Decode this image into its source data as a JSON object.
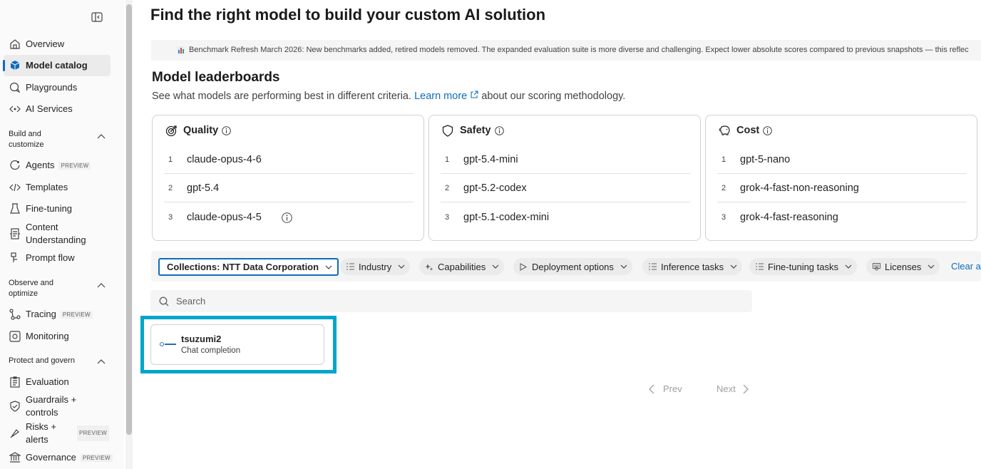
{
  "sidebar": {
    "items": [
      {
        "label": "Overview",
        "icon": "home-icon"
      },
      {
        "label": "Model catalog",
        "icon": "cube-icon",
        "active": true
      },
      {
        "label": "Playgrounds",
        "icon": "chat-icon"
      },
      {
        "label": "AI Services",
        "icon": "code-icon"
      }
    ],
    "build_section": "Build and customize",
    "build_items": [
      {
        "label": "Agents",
        "badge": "PREVIEW"
      },
      {
        "label": "Templates"
      },
      {
        "label": "Fine-tuning"
      },
      {
        "label": "Content Understanding"
      },
      {
        "label": "Prompt flow"
      }
    ],
    "observe_section": "Observe and optimize",
    "observe_items": [
      {
        "label": "Tracing",
        "badge": "PREVIEW"
      },
      {
        "label": "Monitoring"
      }
    ],
    "protect_section": "Protect and govern",
    "protect_items": [
      {
        "label": "Evaluation"
      },
      {
        "label": "Guardrails + controls"
      },
      {
        "label": "Risks + alerts",
        "badge": "PREVIEW"
      },
      {
        "label": "Governance",
        "badge": "PREVIEW"
      }
    ]
  },
  "main": {
    "title": "Find the right model to build your custom AI solution",
    "banner": "Benchmark Refresh March 2026: New benchmarks added, retired models removed. The expanded evaluation suite is more diverse and challenging. Expect lower absolute scores compared to previous snapshots — this reflec",
    "leaderboards": {
      "title": "Model leaderboards",
      "subtitle_pre": "See what models are performing best in different criteria.",
      "learn_more": "Learn more",
      "subtitle_post": "about our scoring methodology.",
      "cards": [
        {
          "title": "Quality",
          "icon": "target-icon",
          "rows": [
            {
              "rank": "1",
              "model": "claude-opus-4-6"
            },
            {
              "rank": "2",
              "model": "gpt-5.4"
            },
            {
              "rank": "3",
              "model": "claude-opus-4-5"
            }
          ]
        },
        {
          "title": "Safety",
          "icon": "shield-icon",
          "rows": [
            {
              "rank": "1",
              "model": "gpt-5.4-mini"
            },
            {
              "rank": "2",
              "model": "gpt-5.2-codex"
            },
            {
              "rank": "3",
              "model": "gpt-5.1-codex-mini"
            }
          ]
        },
        {
          "title": "Cost",
          "icon": "piggy-bank-icon",
          "rows": [
            {
              "rank": "1",
              "model": "gpt-5-nano"
            },
            {
              "rank": "2",
              "model": "grok-4-fast-non-reasoning"
            },
            {
              "rank": "3",
              "model": "grok-4-fast-reasoning"
            }
          ]
        }
      ]
    },
    "filters": {
      "collections": "Collections: NTT Data Corporation",
      "industry": "Industry",
      "capabilities": "Capabilities",
      "deployment": "Deployment options",
      "inference": "Inference tasks",
      "finetuning": "Fine-tuning tasks",
      "licenses": "Licenses",
      "clear_all": "Clear a"
    },
    "search": {
      "placeholder": "Search"
    },
    "models": [
      {
        "name": "tsuzumi2",
        "task": "Chat completion"
      }
    ],
    "pager": {
      "prev": "Prev",
      "next": "Next"
    },
    "accent_color": "#0f6cbd",
    "highlight_color": "#00a6c9"
  }
}
